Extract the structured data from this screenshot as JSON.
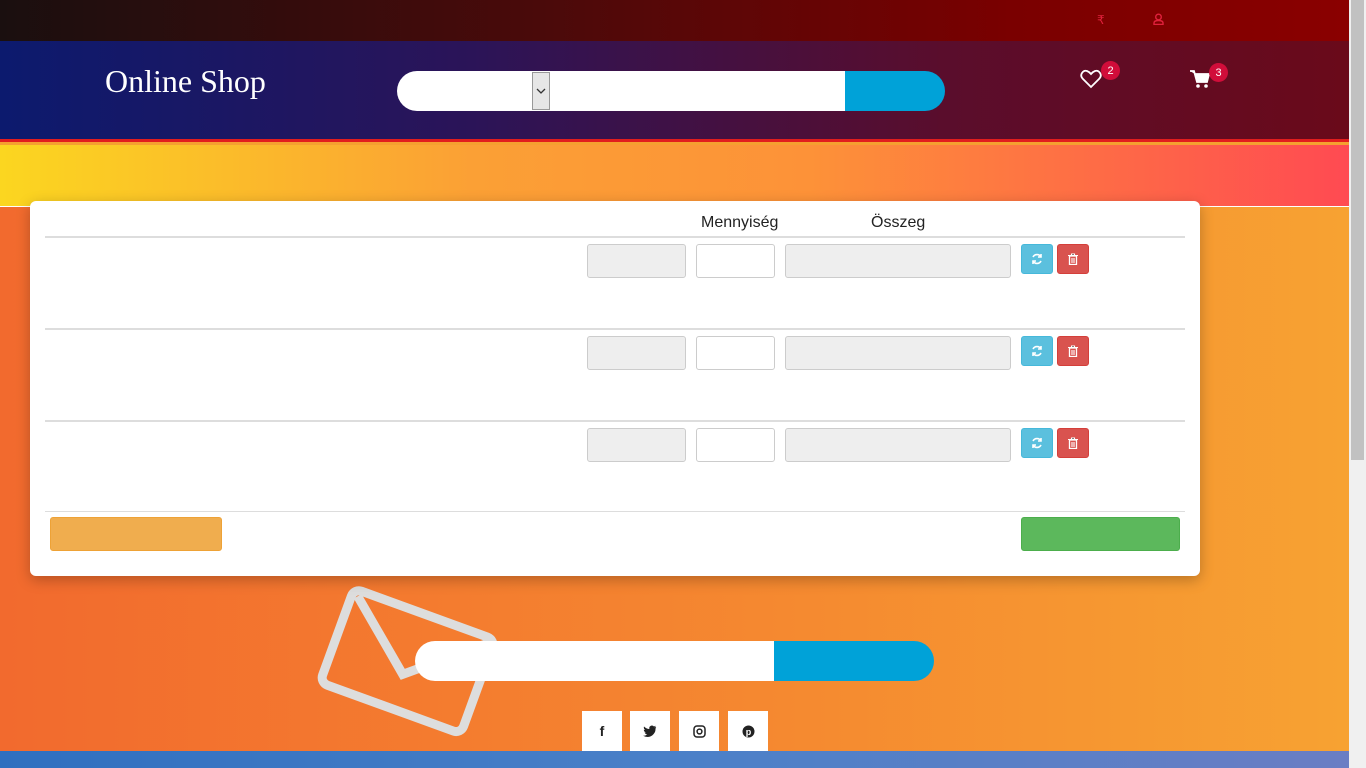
{
  "header": {
    "logo": "Online Shop",
    "wishlist_count": "2",
    "cart_count": "3"
  },
  "topbar": {
    "currency_icon": "₹"
  },
  "cart": {
    "col_quantity": "Mennyiség",
    "col_total": "Összeg",
    "rows": [
      {
        "qty": ""
      },
      {
        "qty": ""
      },
      {
        "qty": ""
      }
    ]
  },
  "icons": {
    "wishlist": "heart-icon",
    "cart": "cart-icon",
    "refresh": "refresh-icon",
    "delete": "trash-icon",
    "user": "user-icon"
  },
  "colors": {
    "accent_blue": "#00a2d8",
    "danger": "#d9534f",
    "info": "#5bc0de",
    "warning": "#f0ad4e",
    "success": "#5cb85c",
    "badge": "#d10d3a"
  },
  "social": {
    "facebook": "f",
    "twitter": "t",
    "instagram": "ig",
    "pinterest": "p"
  }
}
